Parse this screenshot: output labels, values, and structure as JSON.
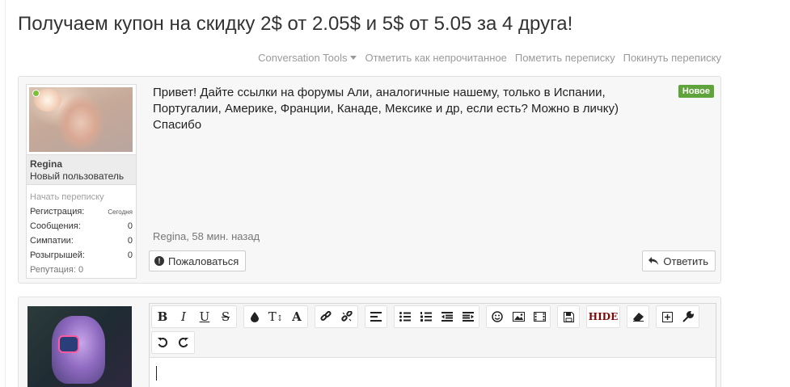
{
  "thread": {
    "title": "Получаем купон на скидку 2$ от 2.05$ и 5$ от 5.05 за 4 друга!"
  },
  "tools": {
    "conversation_tools": "Conversation Tools",
    "mark_unread": "Отметить как непрочитанное",
    "star": "Пометить переписку",
    "leave": "Покинуть переписку"
  },
  "message": {
    "author": "Regina",
    "user_title": "Новый пользователь",
    "start_conversation": "Начать переписку",
    "stats": [
      {
        "label": "Регистрация:",
        "value": "Сегодня"
      },
      {
        "label": "Сообщения:",
        "value": "0"
      },
      {
        "label": "Симпатии:",
        "value": "0"
      },
      {
        "label": "Розыгрышей:",
        "value": "0"
      }
    ],
    "reputation": "Репутация: 0",
    "text": "Привет! Дайте ссылки на форумы Али, аналогичные нашему, только в Испании, Португалии, Америке, Франции, Канаде, Мексике и др, если есть? Можно в личку) Спасибо",
    "badge": "Новое",
    "meta": "Regina, 58 мин. назад",
    "report_label": "Пожаловаться",
    "reply_label": "Ответить",
    "online_color": "#7bbf3a"
  },
  "editor": {
    "toolbar_groups": [
      [
        "bold-icon",
        "italic-icon",
        "underline-icon",
        "strikethrough-icon"
      ],
      [
        "text-color-icon",
        "font-size-icon",
        "font-family-icon"
      ],
      [
        "link-icon",
        "unlink-icon"
      ],
      [
        "align-icon"
      ],
      [
        "bullet-list-icon",
        "numbered-list-icon",
        "outdent-icon",
        "indent-icon"
      ],
      [
        "smiley-icon",
        "image-icon",
        "media-icon"
      ],
      [
        "save-draft-icon"
      ],
      [
        "hide-icon"
      ],
      [
        "eraser-icon"
      ],
      [
        "insert-icon",
        "wrench-icon"
      ],
      [
        "undo-icon",
        "redo-icon"
      ]
    ],
    "hide_label": "HIDE"
  },
  "colors": {
    "badge": "#5fa43a",
    "muted_text": "#9a9a9a"
  }
}
